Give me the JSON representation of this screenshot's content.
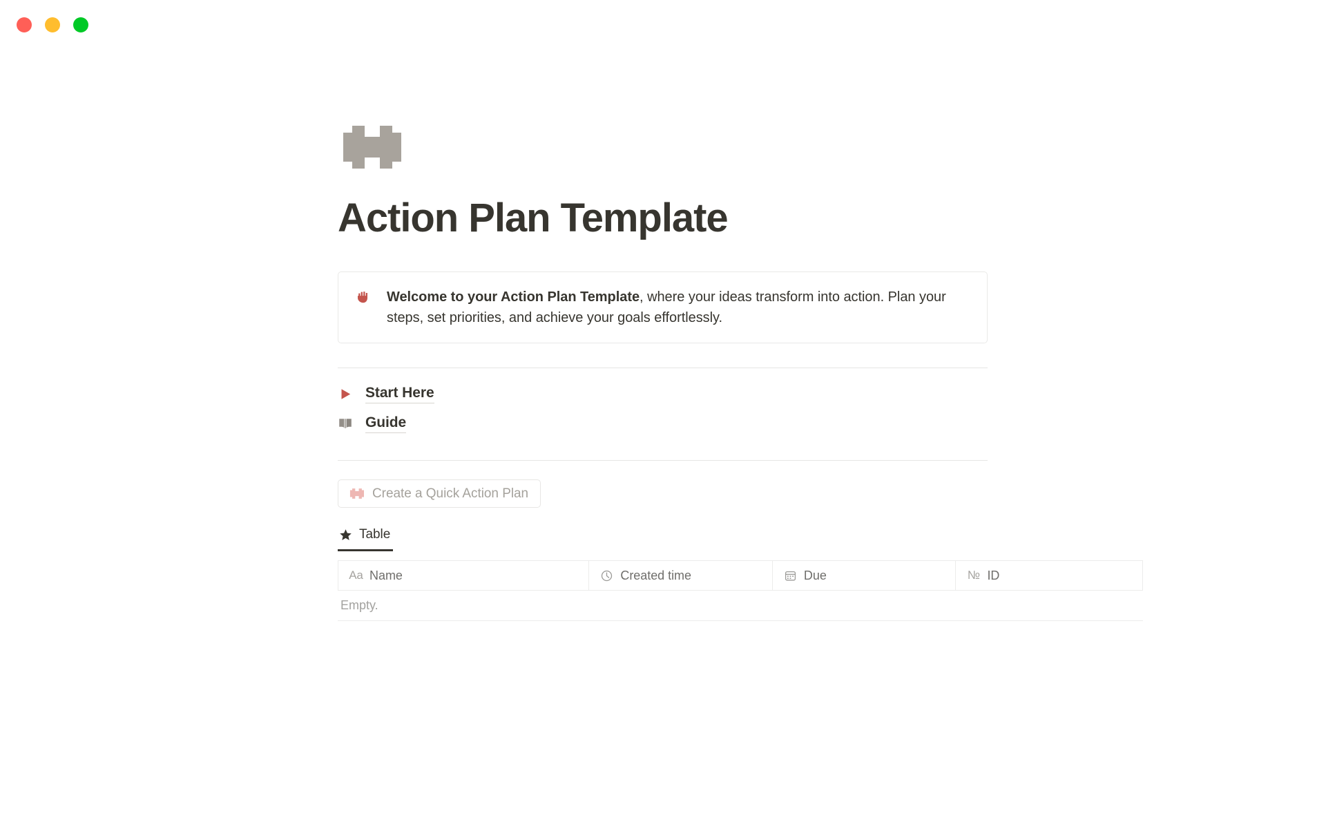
{
  "window": {
    "traffic_lights": [
      {
        "name": "close",
        "color": "#ff5f57"
      },
      {
        "name": "minimize",
        "color": "#ffbd2e"
      },
      {
        "name": "maximize",
        "color": "#00c926"
      }
    ]
  },
  "page": {
    "icon": "dumbbell-icon",
    "icon_color": "#a8a39c",
    "title": "Action Plan Template"
  },
  "callout": {
    "icon": "raised-hand-emoji",
    "icon_color": "#c4554d",
    "text_bold": "Welcome to your Action Plan Template",
    "text_rest": ", where your ideas transform into action. Plan your steps, set priorities, and achieve your goals effortlessly."
  },
  "links": [
    {
      "icon": "play-triangle-icon",
      "icon_color": "#c4554d",
      "label": "Start Here"
    },
    {
      "icon": "open-book-icon",
      "icon_color": "#948f89",
      "label": "Guide"
    }
  ],
  "create_button": {
    "icon": "dumbbell-icon",
    "icon_color": "#eeb7b3",
    "label": "Create a Quick Action Plan"
  },
  "view_tabs": [
    {
      "icon": "star-icon",
      "icon_color": "#37352f",
      "label": "Table",
      "active": true
    }
  ],
  "table": {
    "columns": [
      {
        "icon": "text-aa-icon",
        "label": "Name"
      },
      {
        "icon": "clock-icon",
        "label": "Created time"
      },
      {
        "icon": "calendar-icon",
        "label": "Due"
      },
      {
        "icon": "number-id-icon",
        "label": "ID"
      }
    ],
    "rows": [],
    "empty_label": "Empty."
  }
}
